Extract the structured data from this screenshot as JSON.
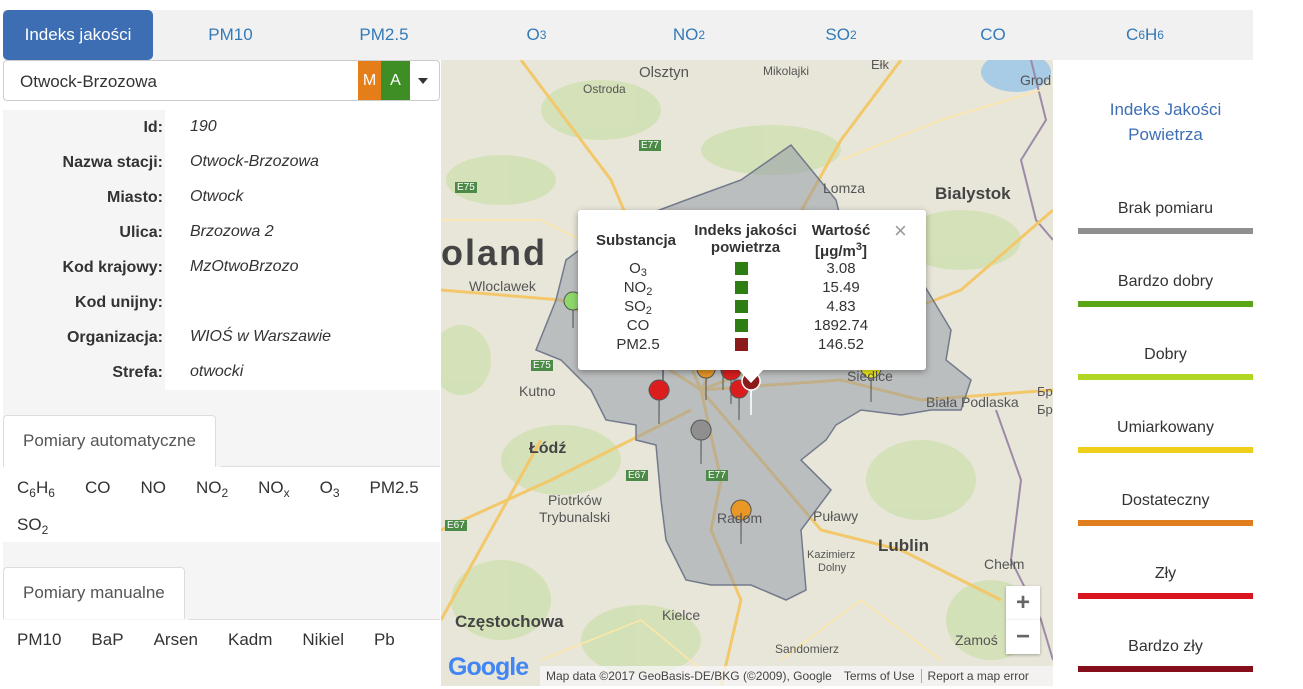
{
  "tabs": [
    {
      "label": "Indeks jakości",
      "sub": "",
      "active": true
    },
    {
      "label": "PM10",
      "sub": ""
    },
    {
      "label": "PM2.5",
      "sub": ""
    },
    {
      "label": "O",
      "sub": "3"
    },
    {
      "label": "NO",
      "sub": "2"
    },
    {
      "label": "SO",
      "sub": "2"
    },
    {
      "label": "CO",
      "sub": ""
    },
    {
      "label": "C",
      "sub": "6",
      "label2": "H",
      "sub2": "6"
    }
  ],
  "station_select": {
    "value": "Otwock-Brzozowa",
    "badge_m": "M",
    "badge_a": "A"
  },
  "info": [
    {
      "key": "Id:",
      "value": "190"
    },
    {
      "key": "Nazwa stacji:",
      "value": "Otwock-Brzozowa"
    },
    {
      "key": "Miasto:",
      "value": "Otwock"
    },
    {
      "key": "Ulica:",
      "value": "Brzozowa 2"
    },
    {
      "key": "Kod krajowy:",
      "value": "MzOtwoBrzozo"
    },
    {
      "key": "Kod unijny:",
      "value": ""
    },
    {
      "key": "Organizacja:",
      "value": "WIOŚ w Warszawie"
    },
    {
      "key": "Strefa:",
      "value": "otwocki"
    }
  ],
  "auto_tab": "Pomiary automatyczne",
  "auto_items": [
    "C6H6",
    "CO",
    "NO",
    "NO2",
    "NOx",
    "O3",
    "PM2.5",
    "SO2"
  ],
  "manual_tab": "Pomiary manualne",
  "manual_items": [
    "PM10",
    "BaP",
    "Arsen",
    "Kadm",
    "Nikiel",
    "Pb"
  ],
  "popup": {
    "head_sub": "Substancja",
    "head_idx_1": "Indeks jakości",
    "head_idx_2": "powietrza",
    "head_val_1": "Wartość",
    "head_val_2": "[μg/m",
    "head_val_sup": "3",
    "head_val_end": "]",
    "rows": [
      {
        "base": "O",
        "sub": "3",
        "value": "3.08",
        "color": "#2e7d12"
      },
      {
        "base": "NO",
        "sub": "2",
        "value": "15.49",
        "color": "#2e7d12"
      },
      {
        "base": "SO",
        "sub": "2",
        "value": "4.83",
        "color": "#2e7d12"
      },
      {
        "base": "CO",
        "sub": "",
        "value": "1892.74",
        "color": "#2e7d12"
      },
      {
        "base": "PM2.5",
        "sub": "",
        "value": "146.52",
        "color": "#8b1a1a"
      }
    ],
    "close": "×"
  },
  "map": {
    "labels": {
      "olsztyn": "Olsztyn",
      "mikolajki": "Mikolajki",
      "elk": "Ełk",
      "ostroda": "Ostroda",
      "lomza": "Lomza",
      "bialystok": "Bialystok",
      "poland": "oland",
      "wloclawek": "Wloclawek",
      "kutno": "Kutno",
      "lodz": "Łódź",
      "siedlce": "Siedlce",
      "biala": "Biała Podlaska",
      "piotrkow": "Piotrków",
      "trybunalski": "Trybunalski",
      "radom": "Radom",
      "pulawy": "Puławy",
      "lublin": "Lublin",
      "kazimierz1": "Kazimierz",
      "kazimierz2": "Dolny",
      "chelm": "Chełm",
      "czestochowa": "Częstochowa",
      "kielce": "Kielce",
      "sandomierz": "Sandomierz",
      "zamosc": "Zamoś",
      "e77a": "E77",
      "e75a": "E75",
      "e75b": "E75",
      "e67a": "E67",
      "e77b": "E77",
      "e67b": "E67",
      "grod": "Grod",
      "br1": "Бр",
      "br2": "Бр"
    },
    "zoom_in": "+",
    "zoom_out": "−",
    "google": "Google",
    "attribution": "Map data ©2017 GeoBasis-DE/BKG (©2009), Google",
    "terms": "Terms of Use",
    "report": "Report a map error"
  },
  "legend": {
    "title_1": "Indeks Jakości",
    "title_2": "Powietrza",
    "items": [
      {
        "label": "Brak pomiaru",
        "color": "#8f8f8f"
      },
      {
        "label": "Bardzo dobry",
        "color": "#5aa515"
      },
      {
        "label": "Dobry",
        "color": "#b0d623"
      },
      {
        "label": "Umiarkowany",
        "color": "#f0cf1a"
      },
      {
        "label": "Dostateczny",
        "color": "#e07d1c"
      },
      {
        "label": "Zły",
        "color": "#d9141c"
      },
      {
        "label": "Bardzo zły",
        "color": "#840f1a"
      }
    ]
  }
}
